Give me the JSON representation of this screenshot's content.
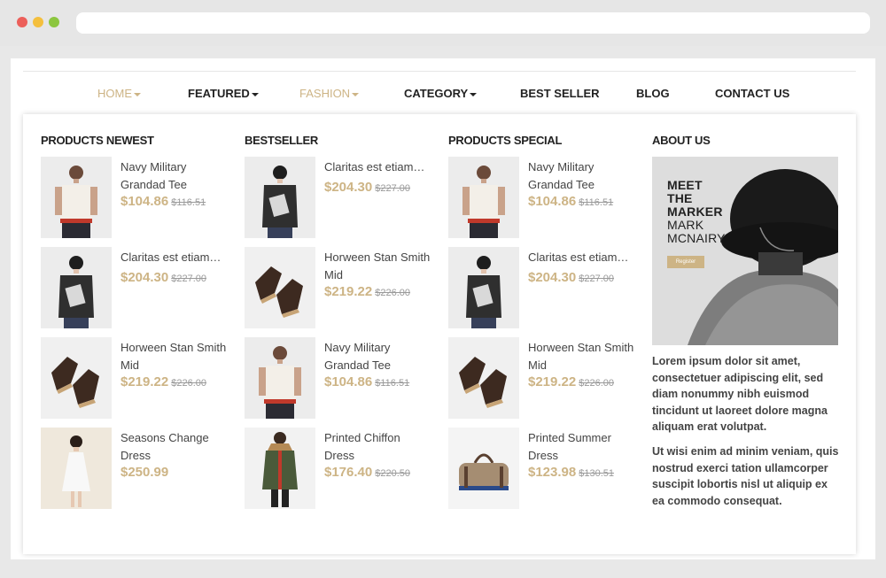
{
  "nav": {
    "items": [
      {
        "label": "HOME",
        "dropdown": true,
        "active": true
      },
      {
        "label": "FEATURED",
        "dropdown": true,
        "active": false
      },
      {
        "label": "FASHION",
        "dropdown": true,
        "active": true
      },
      {
        "label": "CATEGORY",
        "dropdown": true,
        "active": false
      },
      {
        "label": "BEST SELLER",
        "dropdown": false,
        "active": false
      },
      {
        "label": "BLOG",
        "dropdown": false,
        "active": false
      },
      {
        "label": "CONTACT US",
        "dropdown": false,
        "active": false
      }
    ]
  },
  "columns": [
    {
      "title": "PRODUCTS NEWEST",
      "products": [
        {
          "name": "Navy Military Grandad Tee",
          "price": "$104.86",
          "old_price": "$116.51",
          "image": "man-tshirt"
        },
        {
          "name": "Claritas est etiam…",
          "price": "$204.30",
          "old_price": "$227.00",
          "image": "woman-sweater"
        },
        {
          "name": "Horween Stan Smith Mid",
          "price": "$219.22",
          "old_price": "$226.00",
          "image": "boots"
        },
        {
          "name": "Seasons Change Dress",
          "price": "$250.99",
          "old_price": "",
          "image": "white-dress"
        }
      ]
    },
    {
      "title": "BESTSELLER",
      "products": [
        {
          "name": "Claritas est etiam…",
          "price": "$204.30",
          "old_price": "$227.00",
          "image": "woman-sweater"
        },
        {
          "name": "Horween Stan Smith Mid",
          "price": "$219.22",
          "old_price": "$226.00",
          "image": "boots"
        },
        {
          "name": "Navy Military Grandad Tee",
          "price": "$104.86",
          "old_price": "$116.51",
          "image": "man-tshirt"
        },
        {
          "name": "Printed Chiffon Dress",
          "price": "$176.40",
          "old_price": "$220.50",
          "image": "green-parka"
        }
      ]
    },
    {
      "title": "PRODUCTS SPECIAL",
      "products": [
        {
          "name": "Navy Military Grandad Tee",
          "price": "$104.86",
          "old_price": "$116.51",
          "image": "man-tshirt"
        },
        {
          "name": "Claritas est etiam…",
          "price": "$204.30",
          "old_price": "$227.00",
          "image": "woman-sweater"
        },
        {
          "name": "Horween Stan Smith Mid",
          "price": "$219.22",
          "old_price": "$226.00",
          "image": "boots"
        },
        {
          "name": "Printed Summer Dress",
          "price": "$123.98",
          "old_price": "$130.51",
          "image": "duffel-bag"
        }
      ]
    }
  ],
  "about": {
    "title": "ABOUT US",
    "promo": {
      "line1": "MEET",
      "line2": "THE",
      "line3": "MARKER",
      "line4": "MARK",
      "line5": "MCNAIRY",
      "button": "Register"
    },
    "para1": "Lorem ipsum dolor sit amet, consectetuer adipiscing elit, sed diam nonummy nibh euismod tincidunt ut laoreet dolore magna aliquam erat volutpat.",
    "para2": "Ut wisi enim ad minim veniam, quis nostrud exerci tation ullamcorper suscipit lobortis nisl ut aliquip ex ea commodo consequat."
  },
  "colors": {
    "accent": "#cdb485",
    "text": "#222222"
  }
}
